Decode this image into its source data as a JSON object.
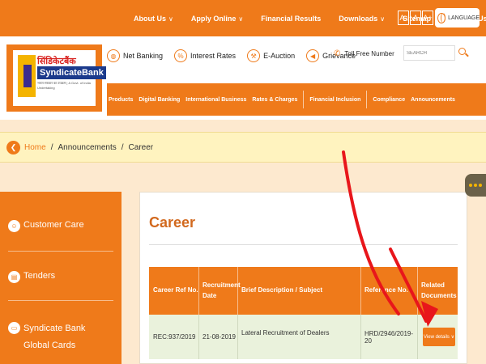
{
  "topnav": {
    "about": "About Us",
    "apply": "Apply Online",
    "financial": "Financial Results",
    "downloads": "Downloads",
    "sitemap": "Sitemap",
    "contact": "Contact Us",
    "font_minus": "A-",
    "font_normal": "A",
    "font_plus": "A+",
    "language": "LANGUAGE"
  },
  "logo": {
    "hindi": "सिंडिकेटबैंक",
    "brand": "SyndicateBank",
    "tagline": "भारत सरकार का उपक्रम | A Govt. of India Undertaking"
  },
  "quicklinks": [
    "Net Banking",
    "Interest Rates",
    "E-Auction",
    "Grievance"
  ],
  "tollfree": "Toll Free Number",
  "search": {
    "placeholder": "SEARCH"
  },
  "mainnav": [
    "Products",
    "Digital Banking",
    "International Business",
    "Rates & Charges",
    "Financial Inclusion",
    "Compliance",
    "Announcements"
  ],
  "breadcrumb": {
    "home": "Home",
    "section": "Announcements",
    "current": "Career"
  },
  "sidebar": [
    "Customer Care",
    "Tenders",
    "Syndicate Bank Global Cards"
  ],
  "content": {
    "title": "Career",
    "headers": [
      "Career Ref No.",
      "Recruitment Date",
      "Brief Description / Subject",
      "Reference No.",
      "Related Documents"
    ],
    "row": {
      "ref": "REC:937/2019",
      "date": "21-08-2019",
      "subject": "Lateral Recruitment of Dealers",
      "refno": "HRD/2946/2019-20",
      "button": "View details"
    }
  },
  "colors": {
    "accent": "#ef7a1a",
    "annotation": "#e8161b"
  }
}
